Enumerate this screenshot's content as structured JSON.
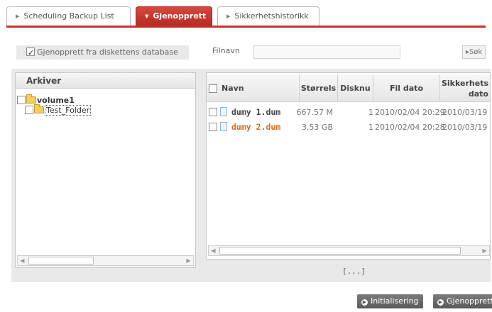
{
  "tabs": [
    {
      "label": "Scheduling Backup List",
      "active": false
    },
    {
      "label": "Gjenopprett",
      "active": true
    },
    {
      "label": "Sikkerhetshistorikk",
      "active": false
    }
  ],
  "filter": {
    "checkbox_label": "Gjenopprett fra diskettens database",
    "checked": true,
    "filename_label": "Filnavn",
    "filename_value": "",
    "search_label": "▸Søk"
  },
  "archive": {
    "header": "Arkiver",
    "tree": [
      {
        "label": "volume1"
      },
      {
        "label": "Test_Folder"
      }
    ]
  },
  "files": {
    "columns": [
      "Navn",
      "Størrelse",
      "Disknu",
      "Fil dato",
      "Sikkerhets dato"
    ],
    "col_labels": {
      "size": "Størrels",
      "disk": "Disknu",
      "sdate_line1": "Sikkerhets",
      "sdate_line2": "dato"
    },
    "rows": [
      {
        "name": "dumy 1.dum",
        "size": "667.57 M",
        "disk": "1",
        "file_date": "2010/02/04 20:29",
        "backup_date": "2010/03/19"
      },
      {
        "name": "dumy 2.dum",
        "size": "3.53 GB",
        "disk": "1",
        "file_date": "2010/02/04 20:28",
        "backup_date": "2010/03/19"
      }
    ]
  },
  "paging": "[...]",
  "actions": {
    "reset_label": "Initialisering",
    "restore_label": "Gjenopprett"
  },
  "colors": {
    "accent": "#c6322a",
    "highlight_name": "#d96a21",
    "button_dark": "#5f5f5f"
  }
}
